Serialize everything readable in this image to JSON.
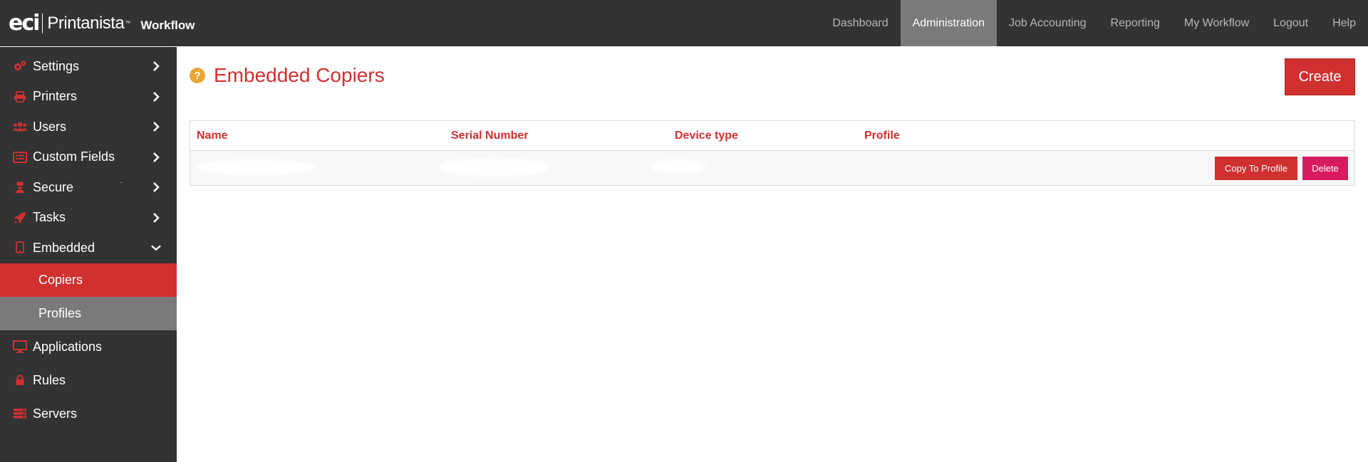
{
  "brand": {
    "logo_text": "eci",
    "product": "Printanista",
    "trademark": "™",
    "workflow": "Workflow"
  },
  "nav": {
    "items": [
      {
        "label": "Dashboard",
        "active": false
      },
      {
        "label": "Administration",
        "active": true
      },
      {
        "label": "Job Accounting",
        "active": false
      },
      {
        "label": "Reporting",
        "active": false
      },
      {
        "label": "My Workflow",
        "active": false
      },
      {
        "label": "Logout",
        "active": false
      },
      {
        "label": "Help",
        "active": false
      }
    ]
  },
  "sidebar": {
    "items": [
      {
        "label": "Settings",
        "icon": "gears-icon",
        "expanded": false
      },
      {
        "label": "Printers",
        "icon": "printer-icon",
        "expanded": false
      },
      {
        "label": "Users",
        "icon": "users-icon",
        "expanded": false
      },
      {
        "label": "Custom Fields",
        "icon": "list-icon",
        "expanded": false
      },
      {
        "label": "Secure",
        "icon": "user-secret-icon",
        "expanded": false
      },
      {
        "label": "Tasks",
        "icon": "rocket-icon",
        "expanded": false
      },
      {
        "label": "Embedded",
        "icon": "tablet-icon",
        "expanded": true
      },
      {
        "label": "Applications",
        "icon": "desktop-icon"
      },
      {
        "label": "Rules",
        "icon": "lock-icon"
      },
      {
        "label": "Servers",
        "icon": "server-icon"
      }
    ],
    "embedded_sub": [
      {
        "label": "Copiers",
        "state": "active"
      },
      {
        "label": "Profiles",
        "state": "hover"
      }
    ]
  },
  "main": {
    "title": "Embedded Copiers",
    "help_glyph": "?",
    "create_label": "Create",
    "table": {
      "columns": [
        "Name",
        "Serial Number",
        "Device type",
        "Profile"
      ],
      "rows": [
        {
          "name": "",
          "serial": "",
          "device_type": "",
          "profile": "",
          "copy_label": "Copy To Profile",
          "delete_label": "Delete"
        }
      ]
    }
  },
  "colors": {
    "accent": "#d03030",
    "dark": "#333333",
    "active_nav": "#7a7a7a",
    "delete": "#d81b60",
    "help": "#e8a634"
  }
}
